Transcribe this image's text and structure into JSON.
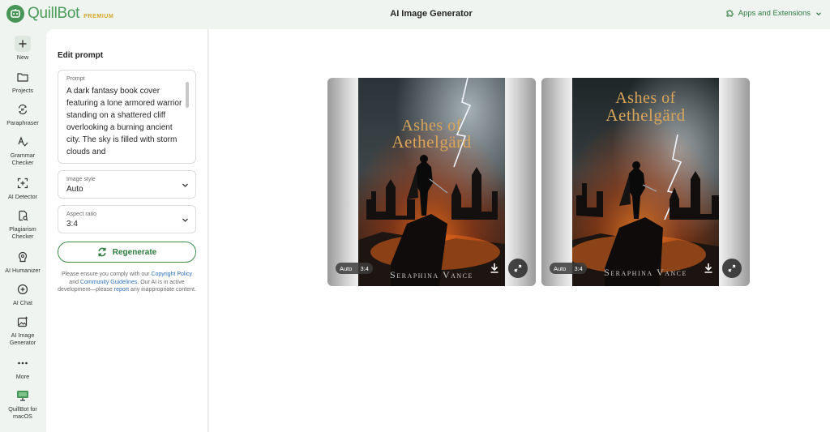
{
  "header": {
    "brand_name": "QuillBot",
    "brand_tier": "PREMIUM",
    "page_title": "AI Image Generator",
    "apps_label": "Apps and Extensions"
  },
  "rail": {
    "items": [
      {
        "label": "New",
        "icon": "plus-icon"
      },
      {
        "label": "Projects",
        "icon": "folder-icon"
      },
      {
        "label": "Paraphraser",
        "icon": "paraphraser-icon"
      },
      {
        "label": "Grammar Checker",
        "icon": "grammar-icon"
      },
      {
        "label": "AI Detector",
        "icon": "ai-detector-icon"
      },
      {
        "label": "Plagiarism Checker",
        "icon": "plagiarism-icon"
      },
      {
        "label": "AI Humanizer",
        "icon": "humanizer-icon"
      },
      {
        "label": "AI Chat",
        "icon": "chat-icon"
      },
      {
        "label": "AI Image Generator",
        "icon": "image-generator-icon"
      },
      {
        "label": "More",
        "icon": "more-icon"
      },
      {
        "label": "QuillBot for macOS",
        "icon": "macos-icon"
      }
    ]
  },
  "panel": {
    "title": "Edit prompt",
    "prompt_label": "Prompt",
    "prompt_text": "A dark fantasy book cover featuring a lone armored warrior standing on a shattered cliff overlooking a burning ancient city. The sky is filled with storm clouds and",
    "style_label": "Image style",
    "style_value": "Auto",
    "ratio_label": "Aspect ratio",
    "ratio_value": "3:4",
    "regenerate_label": "Regenerate",
    "notice_1": "Please ensure you comply with our ",
    "notice_link_1": "Copyright Policy",
    "notice_2": " and ",
    "notice_link_2": "Community Guidelines",
    "notice_3": ". Our AI is in active development—please ",
    "notice_link_3": "report",
    "notice_4": " any inappropriate content."
  },
  "results": [
    {
      "title_line1": "Ashes of",
      "title_line2": "Aethelgärd",
      "author": "Seraphina Vance",
      "style_tag": "Auto",
      "ratio_tag": "3:4"
    },
    {
      "title_line1": "Ashes of",
      "title_line2": "Aethelgärd",
      "author": "Seraphina Vance",
      "style_tag": "Auto",
      "ratio_tag": "3:4"
    }
  ],
  "colors": {
    "brand": "#499557",
    "accent": "#2c7a3e",
    "premium": "#d4a72c",
    "link": "#2f6fb8"
  }
}
